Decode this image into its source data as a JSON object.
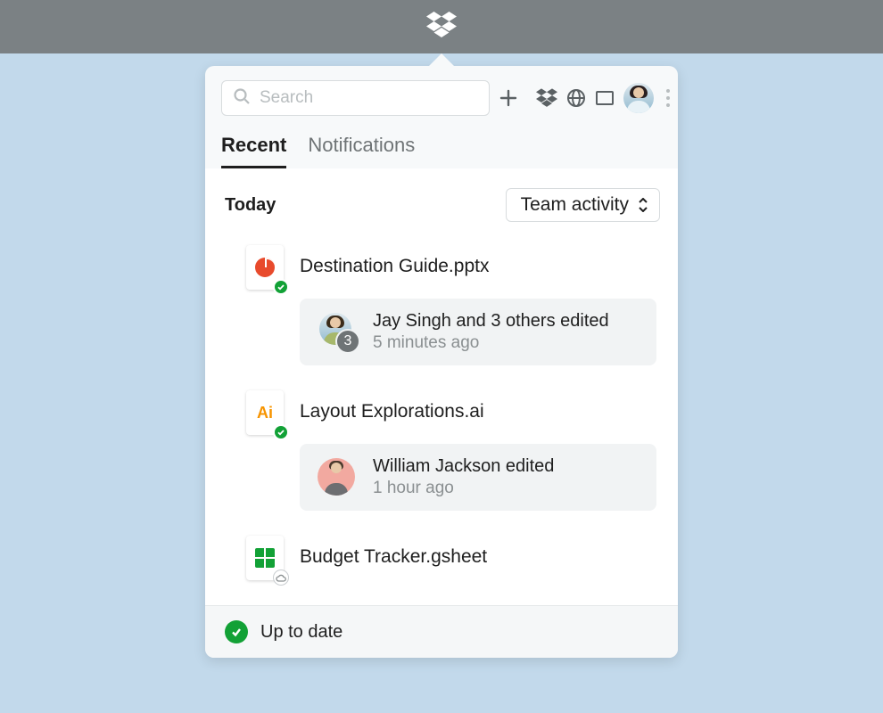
{
  "header": {
    "search_placeholder": "Search"
  },
  "tabs": [
    {
      "label": "Recent",
      "active": true
    },
    {
      "label": "Notifications",
      "active": false
    }
  ],
  "section_title": "Today",
  "filter_label": "Team activity",
  "files": [
    {
      "name": "Destination Guide.pptx",
      "icon": "pptx",
      "badge": "sync",
      "activity": {
        "summary": "Jay Singh and 3 others edited",
        "time": "5 minutes ago",
        "count": "3"
      }
    },
    {
      "name": "Layout Explorations.ai",
      "icon": "ai",
      "badge": "sync",
      "activity": {
        "summary": "William Jackson edited",
        "time": "1 hour ago"
      }
    },
    {
      "name": "Budget Tracker.gsheet",
      "icon": "gsheet",
      "badge": "cloud"
    }
  ],
  "status": "Up to date"
}
